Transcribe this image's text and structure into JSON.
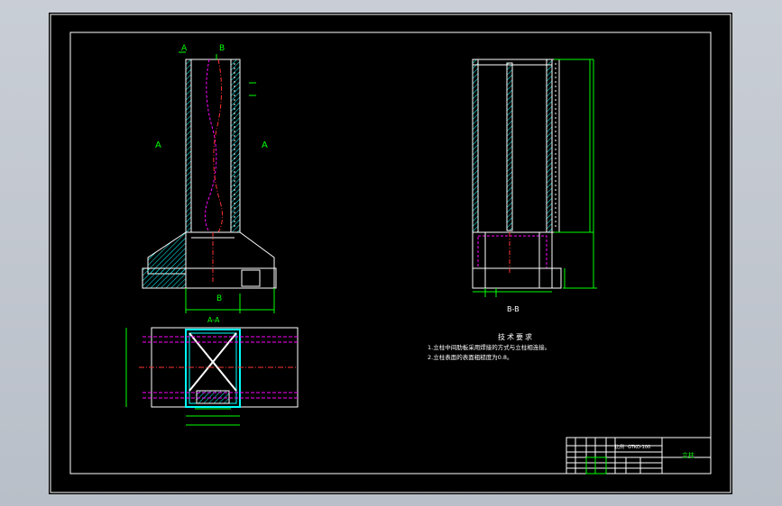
{
  "drawing": {
    "section_marks": {
      "top_left": "A",
      "top_right": "B",
      "left_side": "A",
      "right_side": "A",
      "bottom": "B"
    },
    "view_labels": {
      "section_aa": "A-A",
      "section_bb": "B-B"
    },
    "technical_requirements": {
      "heading": "技术要求",
      "items": [
        "1.立柱中间肋板采用焊接的方式与立柱相连接。",
        "2.立柱表面的表面粗糙度为0.8。"
      ]
    },
    "title_block": {
      "part_name": "立柱",
      "code": "GTKD-100",
      "scale_note": "比例"
    },
    "colors": {
      "outline": "#ffffff",
      "frame": "#ffffff",
      "dimension": "#00ff00",
      "hatch": "#00ffff",
      "hidden": "#ff00ff",
      "center": "#ff3333",
      "sheet_background": "#000000",
      "desktop": "#c3c8d0"
    }
  }
}
